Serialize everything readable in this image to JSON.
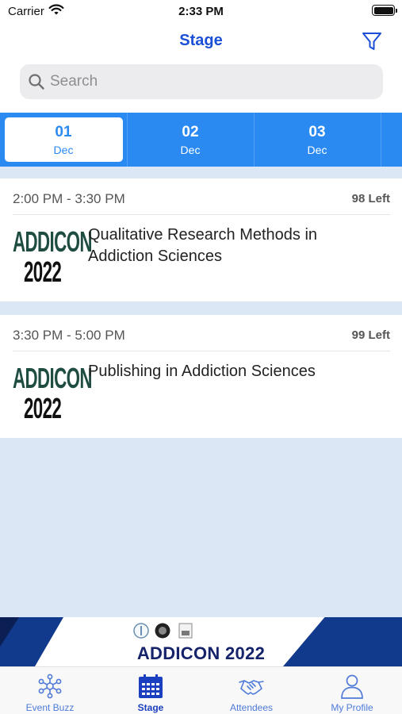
{
  "status_bar": {
    "carrier": "Carrier",
    "time": "2:33 PM"
  },
  "nav": {
    "title": "Stage",
    "filter_icon": "filter-icon"
  },
  "search": {
    "placeholder": "Search",
    "icon": "search-icon"
  },
  "date_tabs": [
    {
      "day": "01",
      "month": "Dec",
      "selected": true
    },
    {
      "day": "02",
      "month": "Dec",
      "selected": false
    },
    {
      "day": "03",
      "month": "Dec",
      "selected": false
    }
  ],
  "sessions": [
    {
      "time": "2:00 PM - 3:30 PM",
      "seats_left": "98 Left",
      "logo_line1": "ADDICON",
      "logo_line2": "2022",
      "title": "Qualitative Research Methods in Addiction Sciences"
    },
    {
      "time": "3:30 PM - 5:00 PM",
      "seats_left": "99 Left",
      "logo_line1": "ADDICON",
      "logo_line2": "2022",
      "title": "Publishing in Addiction Sciences"
    }
  ],
  "banner": {
    "title": "ADDICON 2022"
  },
  "tab_bar": [
    {
      "label": "Event Buzz",
      "icon": "network-icon",
      "active": false
    },
    {
      "label": "Stage",
      "icon": "calendar-icon",
      "active": true
    },
    {
      "label": "Attendees",
      "icon": "handshake-icon",
      "active": false
    },
    {
      "label": "My Profile",
      "icon": "person-icon",
      "active": false
    }
  ],
  "colors": {
    "accent": "#1a4fd6",
    "date_bar": "#2b8af2",
    "list_bg": "#dce7f6",
    "banner_navy": "#123a8c"
  }
}
